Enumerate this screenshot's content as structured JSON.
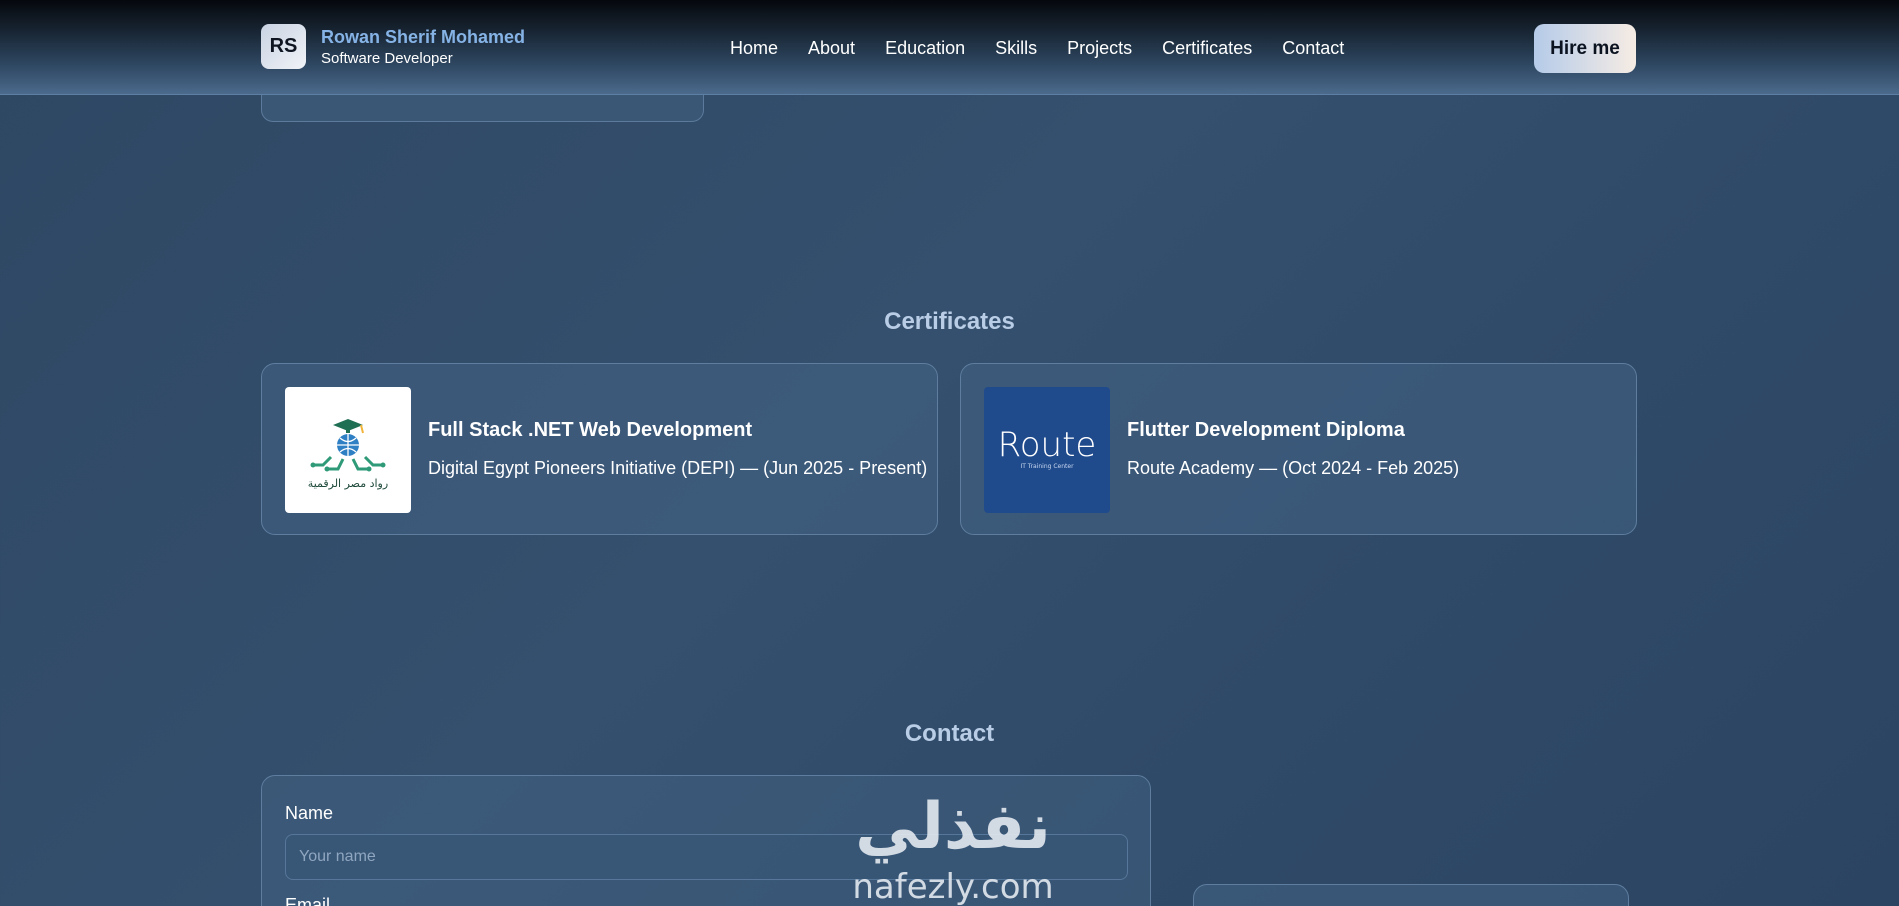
{
  "header": {
    "avatar_initials": "RS",
    "name": "Rowan Sherif Mohamed",
    "role": "Software Developer",
    "nav": [
      "Home",
      "About",
      "Education",
      "Skills",
      "Projects",
      "Certificates",
      "Contact"
    ],
    "hire_label": "Hire me"
  },
  "certificates": {
    "title": "Certificates",
    "items": [
      {
        "title": "Full Stack .NET Web Development",
        "subtitle": "Digital Egypt Pioneers Initiative (DEPI) — (Jun 2025 - Present)",
        "logo_text": "رواد مصر الرقمية",
        "logo_icon": "graduation-globe-logo"
      },
      {
        "title": "Flutter Development Diploma",
        "subtitle": "Route Academy — (Oct 2024 - Feb 2025)",
        "logo_text": "Route",
        "logo_tagline": "IT Training Center",
        "logo_color": "#1f4a8c"
      }
    ]
  },
  "contact": {
    "title": "Contact",
    "name_label": "Name",
    "name_placeholder": "Your name",
    "email_label": "Email"
  },
  "watermark": {
    "arabic": "نفذلي",
    "latin": "nafezly.com"
  }
}
